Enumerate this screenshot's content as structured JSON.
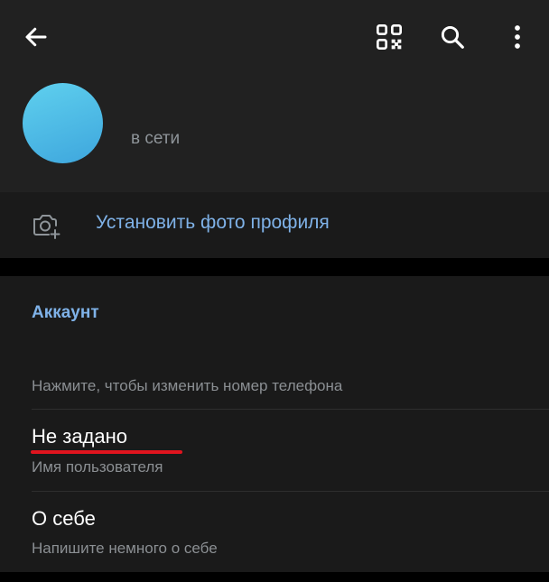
{
  "toolbar": {
    "back_icon": "arrow-left-icon",
    "qr_icon": "qr-code-icon",
    "search_icon": "search-icon",
    "more_icon": "more-vertical-icon"
  },
  "profile": {
    "status": "в сети",
    "avatar_color": "#4ab8e4"
  },
  "photo": {
    "icon": "camera-add-icon",
    "label": "Установить фото профиля"
  },
  "account": {
    "title": "Аккаунт",
    "phone_hint": "Нажмите, чтобы изменить номер телефона",
    "username": {
      "value": "Не задано",
      "label": "Имя пользователя"
    },
    "bio": {
      "value": "О себе",
      "label": "Напишите немного о себе"
    }
  },
  "colors": {
    "accent": "#7fb2e8",
    "background": "#1a1a1a",
    "header": "#212121",
    "highlight": "#e0141e"
  }
}
